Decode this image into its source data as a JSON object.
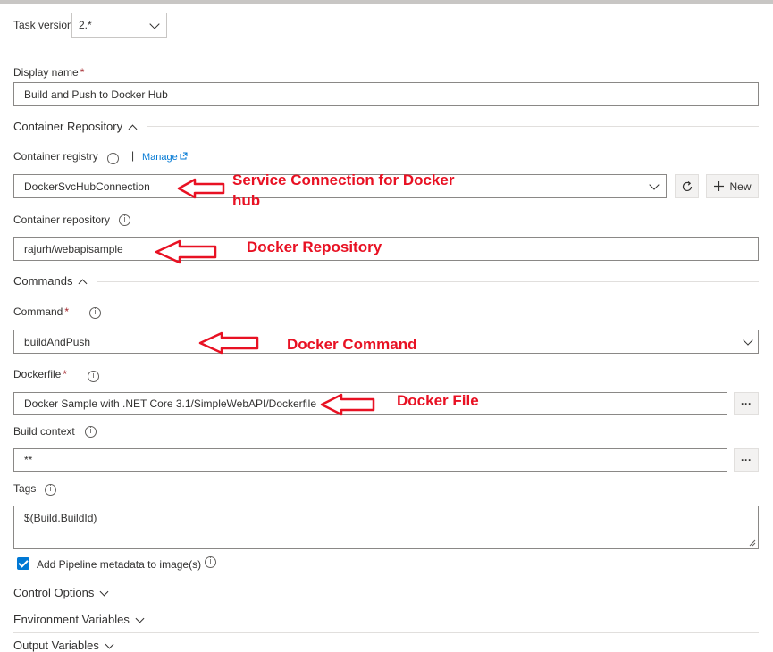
{
  "task_version": {
    "label": "Task version",
    "value": "2.*"
  },
  "display_name": {
    "label": "Display name",
    "required": "*",
    "value": "Build and Push to Docker Hub"
  },
  "container_repository_section": {
    "title": "Container Repository"
  },
  "container_registry": {
    "label": "Container registry",
    "manage": "Manage",
    "value": "DockerSvcHubConnection",
    "new_button": "New"
  },
  "container_repository": {
    "label": "Container repository",
    "value": "rajurh/webapisample"
  },
  "commands_section": {
    "title": "Commands"
  },
  "command": {
    "label": "Command",
    "required": "*",
    "value": "buildAndPush"
  },
  "dockerfile": {
    "label": "Dockerfile",
    "required": "*",
    "value": "Docker Sample with .NET Core 3.1/SimpleWebAPI/Dockerfile",
    "browse": "···"
  },
  "build_context": {
    "label": "Build context",
    "value": "**",
    "browse": "···"
  },
  "tags": {
    "label": "Tags",
    "value": "$(Build.BuildId)"
  },
  "pipeline_metadata": {
    "label": "Add Pipeline metadata to image(s)",
    "checked": true
  },
  "control_options": {
    "title": "Control Options"
  },
  "environment_variables": {
    "title": "Environment Variables"
  },
  "output_variables": {
    "title": "Output Variables"
  },
  "annotations": {
    "service_connection_line1": "Service Connection for Docker",
    "service_connection_line2": "hub",
    "docker_repository": "Docker Repository",
    "docker_command": "Docker Command",
    "docker_file": "Docker File"
  },
  "colors": {
    "annotation": "#e81123",
    "accent": "#0078d4",
    "border": "#8a8886"
  },
  "icons": [
    "info-icon",
    "chevron-down-icon",
    "chevron-up-icon",
    "refresh-icon",
    "plus-icon",
    "external-link-icon",
    "ellipsis-icon",
    "checkmark-icon",
    "arrow-icon"
  ]
}
